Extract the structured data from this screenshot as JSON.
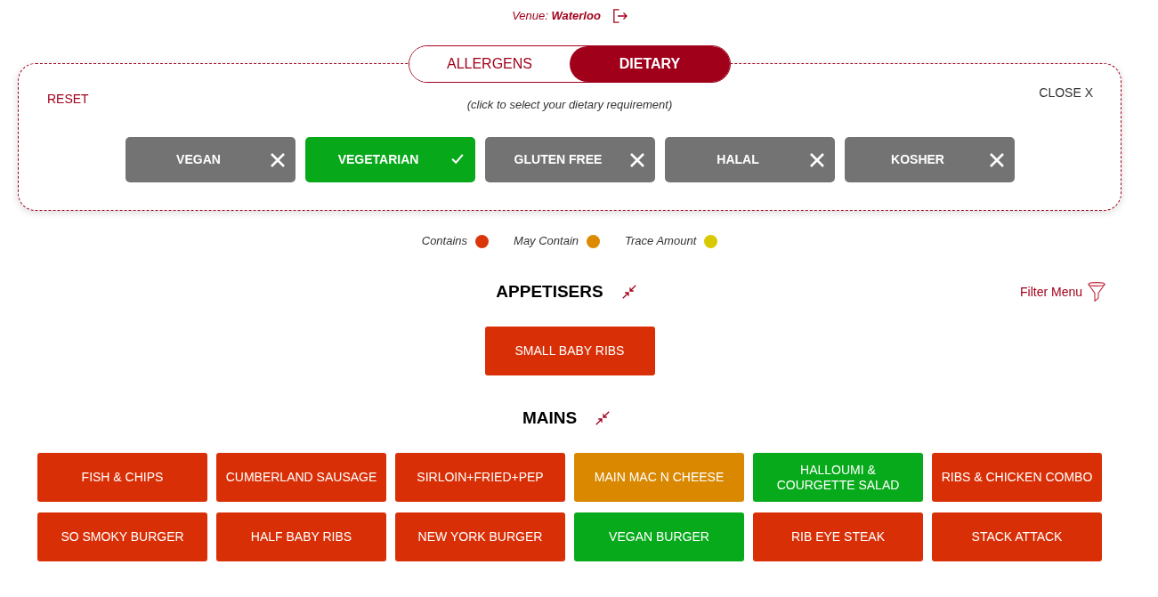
{
  "venue": {
    "text": "Venue: **Waterloo**"
  },
  "mode_tabs": [
    {
      "label": "ALLERGENS",
      "selected": false
    },
    {
      "label": "DIETARY",
      "selected": true
    }
  ],
  "panel": {
    "reset": "RESET",
    "close": "CLOSE X",
    "hint": "(click to select your dietary requirement)",
    "options": [
      {
        "label": "VEGAN",
        "selected": false
      },
      {
        "label": "VEGETARIAN",
        "selected": true
      },
      {
        "label": "GLUTEN FREE",
        "selected": false
      },
      {
        "label": "HALAL",
        "selected": false
      },
      {
        "label": "KOSHER",
        "selected": false
      }
    ]
  },
  "legend": [
    {
      "label": "Contains",
      "color": "#d9360b"
    },
    {
      "label": "May Contain",
      "color": "#dc8a00"
    },
    {
      "label": "Trace Amount",
      "color": "#d8c900"
    }
  ],
  "filter_menu": {
    "label": "Filter Menu"
  },
  "sections": [
    {
      "title": "APPETISERS",
      "items": [
        {
          "label": "SMALL BABY RIBS",
          "color": "#d92f06"
        }
      ]
    },
    {
      "title": "MAINS",
      "items": [
        {
          "label": "FISH & CHIPS",
          "color": "#d92f06"
        },
        {
          "label": "CUMBERLAND SAUSAGE",
          "color": "#d92f06"
        },
        {
          "label": "SIRLOIN+FRIED+PEP",
          "color": "#d92f06"
        },
        {
          "label": "MAIN MAC N CHEESE",
          "color": "#d98800"
        },
        {
          "label": "HALLOUMI & COURGETTE SALAD",
          "color": "#07aa1a"
        },
        {
          "label": "RIBS & CHICKEN COMBO",
          "color": "#d92f06"
        },
        {
          "label": "SO SMOKY BURGER",
          "color": "#d92f06"
        },
        {
          "label": "HALF BABY RIBS",
          "color": "#d92f06"
        },
        {
          "label": "NEW YORK BURGER",
          "color": "#d92f06"
        },
        {
          "label": "VEGAN BURGER",
          "color": "#07aa1a"
        },
        {
          "label": "RIB EYE STEAK",
          "color": "#d92f06"
        },
        {
          "label": "STACK ATTACK",
          "color": "#d92f06"
        }
      ]
    }
  ]
}
